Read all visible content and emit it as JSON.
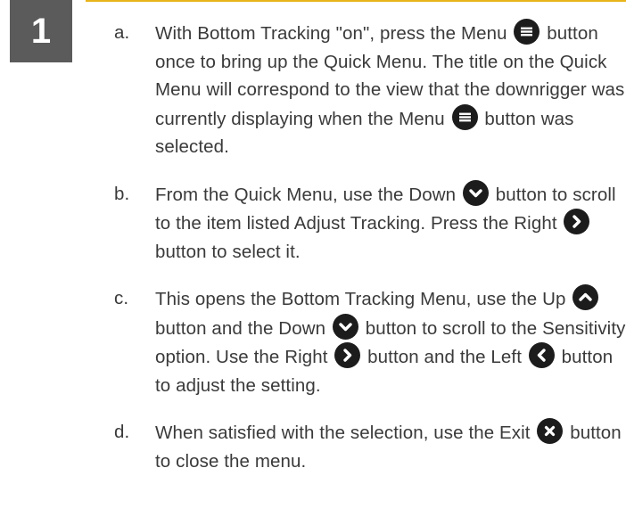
{
  "step": {
    "number": "1"
  },
  "accent_color": "#e8b419",
  "items": [
    {
      "marker": "a.",
      "parts": [
        "With Bottom Tracking \"on\", press the Menu",
        "button once to bring up the Quick Menu. The title on the Quick Menu will correspond to the view that the downrigger was currently displaying when the Menu",
        "button was selected."
      ]
    },
    {
      "marker": "b.",
      "parts": [
        "From the Quick Menu, use the Down",
        "button to scroll to the item listed Adjust Tracking. Press the Right",
        "button to select it."
      ]
    },
    {
      "marker": "c.",
      "parts": [
        "This opens the Bottom Tracking Menu, use the Up",
        "button and the Down",
        "button to scroll to the Sensitivity option. Use the Right",
        "button and the Left",
        "button to adjust the setting."
      ]
    },
    {
      "marker": "d.",
      "parts": [
        "When satisfied with the selection, use the Exit",
        "button to close the menu."
      ]
    }
  ],
  "icons": {
    "menu": "menu-icon",
    "down": "chevron-down-icon",
    "up": "chevron-up-icon",
    "right": "chevron-right-icon",
    "left": "chevron-left-icon",
    "exit": "close-icon"
  }
}
